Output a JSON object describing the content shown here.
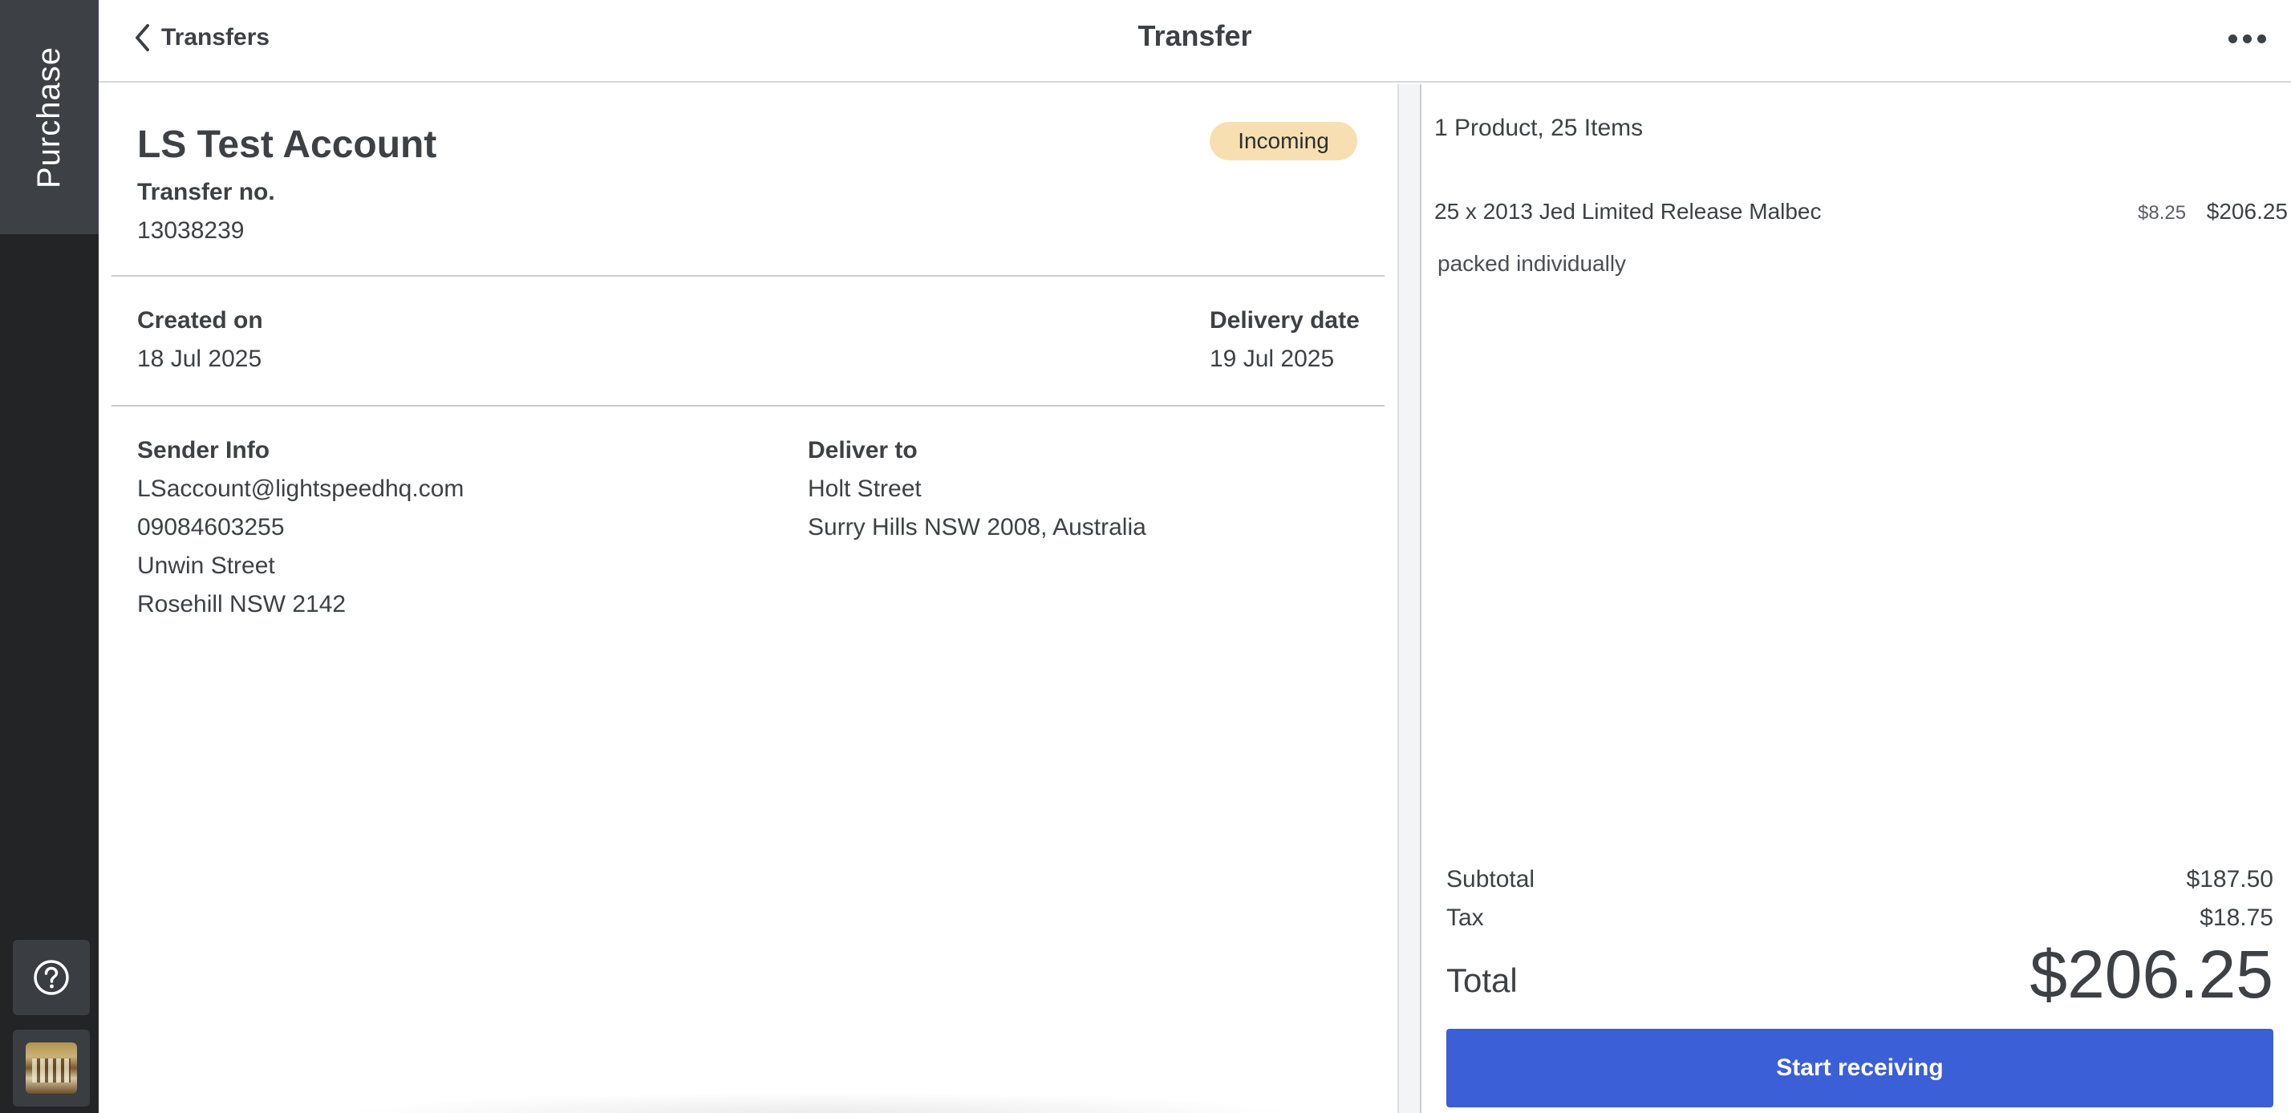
{
  "sidebar": {
    "active_tab": "Purchase",
    "help_icon": "help-circle-icon",
    "avatar_icon": "store-avatar"
  },
  "header": {
    "back_label": "Transfers",
    "title": "Transfer",
    "more_icon": "more-horizontal-icon"
  },
  "transfer": {
    "account_name": "LS Test Account",
    "status": "Incoming",
    "status_color": "#f8dfb2",
    "transfer_no_label": "Transfer no.",
    "transfer_no": "13038239",
    "created_label": "Created on",
    "created_date": "18 Jul 2025",
    "delivery_label": "Delivery date",
    "delivery_date": "19 Jul 2025"
  },
  "sender": {
    "label": "Sender Info",
    "email": "LSaccount@lightspeedhq.com",
    "phone": "09084603255",
    "street": "Unwin Street",
    "city": "Rosehill NSW 2142"
  },
  "deliver_to": {
    "label": "Deliver to",
    "street": "Holt Street",
    "city": "Surry Hills NSW 2008, Australia"
  },
  "order": {
    "summary": "1 Product, 25 Items",
    "lines": [
      {
        "description": "25 x 2013 Jed Limited Release Malbec",
        "unit_price": "$8.25",
        "total": "$206.25",
        "note": "packed individually"
      }
    ],
    "subtotal_label": "Subtotal",
    "subtotal": "$187.50",
    "tax_label": "Tax",
    "tax": "$18.75",
    "total_label": "Total",
    "total": "$206.25",
    "action_label": "Start receiving",
    "action_color": "#3b5fd6"
  }
}
